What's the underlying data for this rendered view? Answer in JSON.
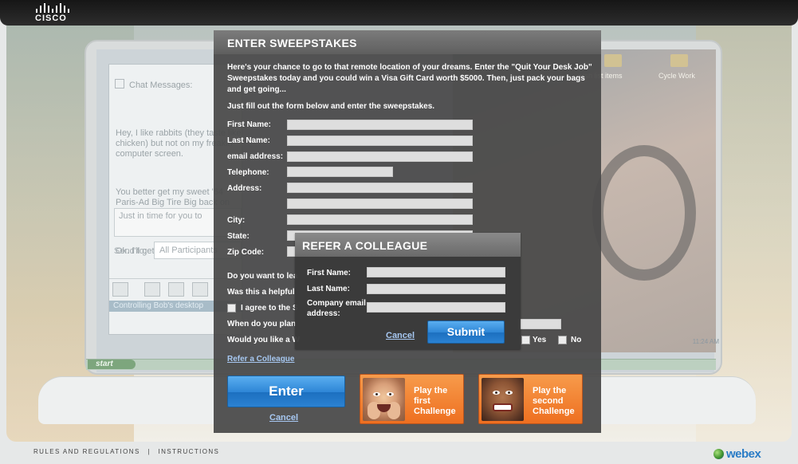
{
  "brand": {
    "logo_text": "CISCO",
    "product": "webex"
  },
  "background": {
    "chat": {
      "title": "Chat Messages:",
      "messages": [
        "Hey, I like rabbits (they taste like chicken) but not on my freakin' computer screen.",
        "You better get my sweet '64 Paris-Ad Big Tire Big back on my PC...or you better go.",
        "Ok. I'll get rid of those"
      ],
      "input_text": "Just in time for you to",
      "send_to_label": "Send to:",
      "send_to_value": "All Participants",
      "status": "Controlling Bob's desktop"
    },
    "desktop_icons": [
      {
        "label": "wish list items"
      },
      {
        "label": "Cycle Work"
      }
    ],
    "start_label": "start",
    "tray_time": "11:24 AM"
  },
  "sweepstakes": {
    "title": "ENTER SWEEPSTAKES",
    "intro": "Here's your chance to go to that remote location of your dreams. Enter the \"Quit Your Desk Job\" Sweepstakes today and you could win a Visa Gift Card worth $5000. Then, just pack your bags and get going...",
    "fill_prompt": "Just fill out the form below and enter the sweepstakes.",
    "fields": [
      {
        "label": "First Name:"
      },
      {
        "label": "Last Name:"
      },
      {
        "label": "email address:"
      },
      {
        "label": "Telephone:"
      },
      {
        "label": "Address:"
      },
      {
        "label": ""
      },
      {
        "label": "City:"
      },
      {
        "label": "State:"
      },
      {
        "label": "Zip Code:"
      }
    ],
    "questions": [
      "Do you want to lea",
      "Was this a helpful",
      "I agree to the S",
      "When do you plan",
      "Would you like a W"
    ],
    "yes_label": "Yes",
    "no_label": "No",
    "refer_link": "Refer a Colleague",
    "enter_label": "Enter",
    "cancel_label": "Cancel",
    "challenges": [
      {
        "label": "Play the first Challenge"
      },
      {
        "label": "Play the second Challenge"
      }
    ]
  },
  "refer": {
    "title": "REFER A COLLEAGUE",
    "fields": [
      {
        "label": "First Name:"
      },
      {
        "label": "Last Name:"
      },
      {
        "label": "Company email address:"
      }
    ],
    "cancel_label": "Cancel",
    "submit_label": "Submit"
  },
  "footer": {
    "rules_label": "RULES AND REGULATIONS",
    "separator": "|",
    "instructions_label": "INSTRUCTIONS"
  }
}
